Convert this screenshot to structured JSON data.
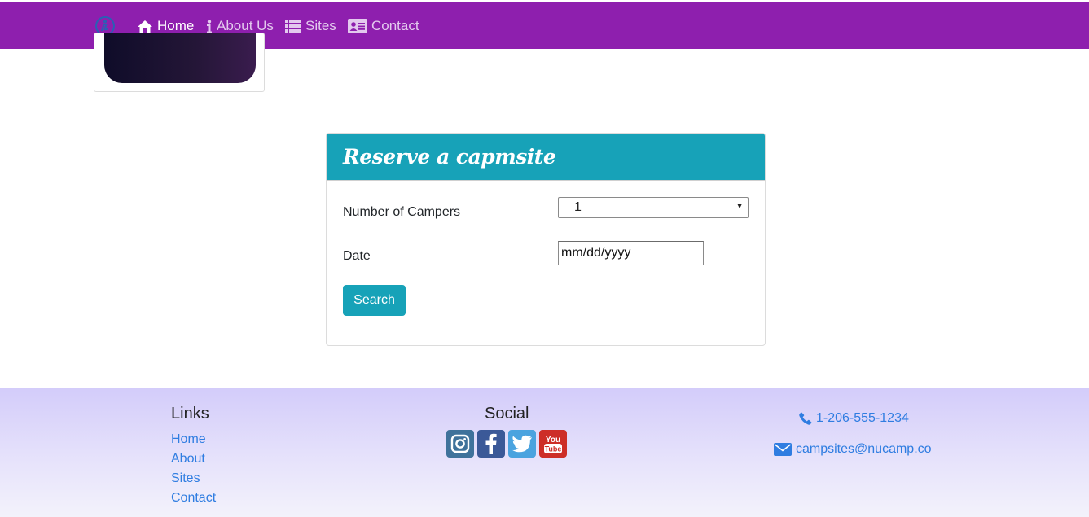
{
  "nav": {
    "items": [
      {
        "label": "Home",
        "icon": "home-icon",
        "active": true
      },
      {
        "label": "About Us",
        "icon": "info-icon",
        "active": false
      },
      {
        "label": "Sites",
        "icon": "list-icon",
        "active": false
      },
      {
        "label": "Contact",
        "icon": "address-card-icon",
        "active": false
      }
    ]
  },
  "reservation": {
    "title": "Reserve a capmsite",
    "campers_label": "Number of Campers",
    "campers_value": "1",
    "date_label": "Date",
    "date_placeholder": "mm/dd/yyyy",
    "search_label": "Search"
  },
  "footer": {
    "links_heading": "Links",
    "links": [
      "Home",
      "About",
      "Sites",
      "Contact"
    ],
    "social_heading": "Social",
    "social_icons": [
      "instagram-icon",
      "facebook-icon",
      "twitter-icon",
      "youtube-icon"
    ],
    "phone": "1-206-555-1234",
    "email": "campsites@nucamp.co"
  },
  "colors": {
    "navbar": "#8e1fae",
    "accent": "#17a2b8",
    "link": "#2f7de1"
  }
}
